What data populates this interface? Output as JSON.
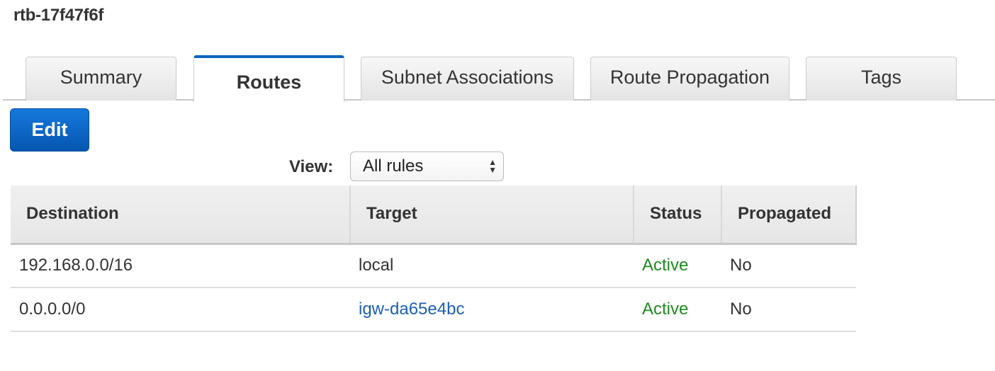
{
  "header": {
    "title": "rtb-17f47f6f"
  },
  "tabs": [
    {
      "label": "Summary",
      "active": false
    },
    {
      "label": "Routes",
      "active": true
    },
    {
      "label": "Subnet Associations",
      "active": false
    },
    {
      "label": "Route Propagation",
      "active": false
    },
    {
      "label": "Tags",
      "active": false
    }
  ],
  "toolbar": {
    "edit_label": "Edit"
  },
  "view_filter": {
    "label": "View:",
    "selected": "All rules",
    "icon": "up-down-arrows-icon"
  },
  "table": {
    "columns": [
      "Destination",
      "Target",
      "Status",
      "Propagated"
    ],
    "rows": [
      {
        "destination": "192.168.0.0/16",
        "target": "local",
        "target_is_link": false,
        "status": "Active",
        "propagated": "No"
      },
      {
        "destination": "0.0.0.0/0",
        "target": "igw-da65e4bc",
        "target_is_link": true,
        "status": "Active",
        "propagated": "No"
      }
    ]
  },
  "colors": {
    "accent": "#0a64c0",
    "button": "#0d68c8",
    "status_active": "#1d8b1d",
    "link": "#1a5fb4"
  }
}
